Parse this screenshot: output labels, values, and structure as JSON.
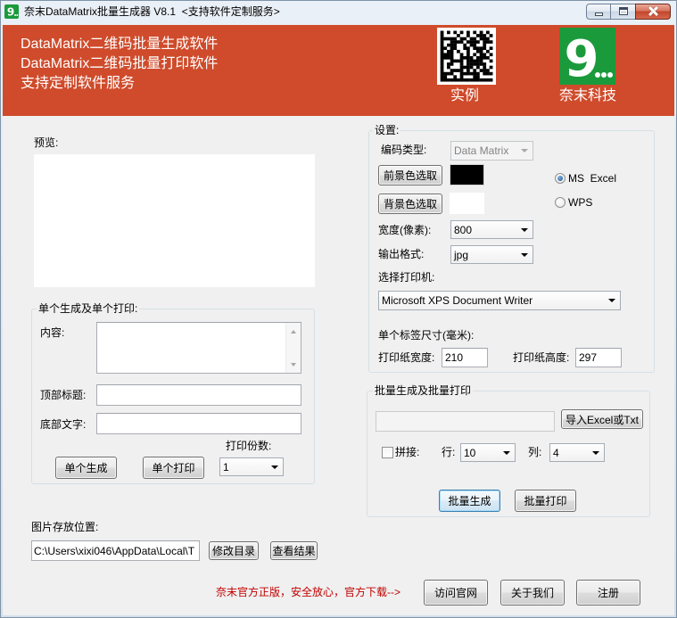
{
  "window": {
    "title": "奈末DataMatrix批量生成器 V8.1  <支持软件定制服务>",
    "icon_text": "9"
  },
  "banner": {
    "color": "#cf4b2b",
    "lines": [
      "DataMatrix二维码批量生成软件",
      "DataMatrix二维码批量打印软件",
      "支持定制软件服务"
    ],
    "sample_label": "实例",
    "company_label": "奈末科技",
    "logo_text": "9",
    "logo_color": "#1b9a3c"
  },
  "preview": {
    "label": "预览:"
  },
  "single": {
    "group_label": "单个生成及单个打印:",
    "content_label": "内容:",
    "top_title_label": "顶部标题:",
    "bottom_text_label": "底部文字:",
    "copies_label": "打印份数:",
    "copies_value": "1",
    "generate_button": "单个生成",
    "print_button": "单个打印"
  },
  "output": {
    "folder_label": "图片存放位置:",
    "folder_value": "C:\\Users\\xixi046\\AppData\\Local\\T",
    "change_dir_button": "修改目录",
    "view_results_button": "查看结果"
  },
  "settings": {
    "group_label": "设置:",
    "encoding_label": "编码类型:",
    "encoding_value": "Data Matrix",
    "foreground_button": "前景色选取",
    "foreground_color": "#000000",
    "background_button": "背景色选取",
    "background_color": "#ffffff",
    "file_type_options": [
      {
        "label": "MS  Excel",
        "checked": true
      },
      {
        "label": "WPS",
        "checked": false
      }
    ],
    "width_label": "宽度(像素):",
    "width_value": "800",
    "format_label": "输出格式:",
    "format_value": "jpg",
    "printer_label": "选择打印机:",
    "printer_value": "Microsoft XPS Document Writer",
    "label_size_label": "单个标签尺寸(毫米):",
    "paper_width_label": "打印纸宽度:",
    "paper_width_value": "210",
    "paper_height_label": "打印纸高度:",
    "paper_height_value": "297"
  },
  "batch": {
    "group_label": "批量生成及批量打印",
    "import_button": "导入Excel或Txt",
    "stitch_label": "拼接:",
    "stitch_checked": false,
    "rows_label": "行:",
    "rows_value": "10",
    "cols_label": "列:",
    "cols_value": "4",
    "generate_button": "批量生成",
    "print_button": "批量打印"
  },
  "footer": {
    "notice": "奈末官方正版，安全放心，官方下载-->",
    "notice_color": "#c00000",
    "website_button": "访问官网",
    "about_button": "关于我们",
    "register_button": "注册"
  }
}
